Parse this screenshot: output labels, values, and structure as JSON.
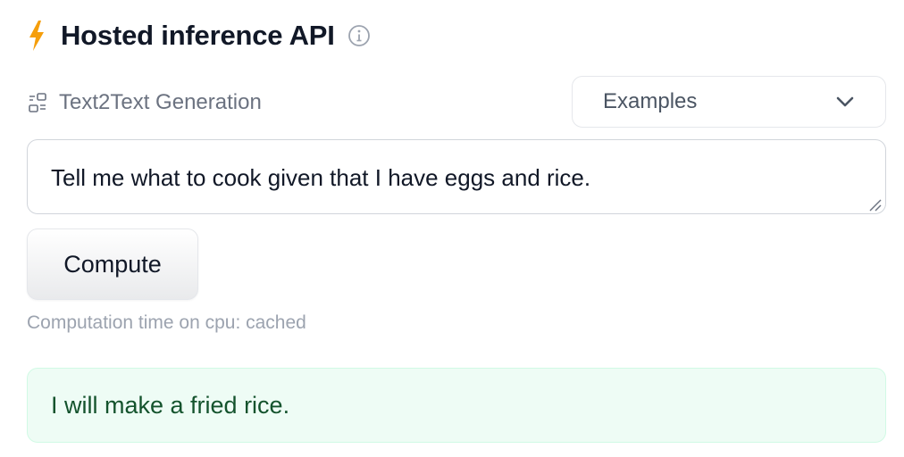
{
  "header": {
    "title": "Hosted inference API",
    "bolt_icon": "lightning-bolt-icon",
    "info_icon": "info-icon"
  },
  "task": {
    "icon": "task-icon",
    "label": "Text2Text Generation"
  },
  "examples": {
    "label": "Examples",
    "icon": "chevron-down-icon"
  },
  "input": {
    "value": "Tell me what to cook given that I have eggs and rice."
  },
  "compute": {
    "label": "Compute"
  },
  "computation_time": "Computation time on cpu: cached",
  "output": {
    "text": "I will make a fried rice."
  },
  "colors": {
    "accent": "#f59e0b",
    "output_bg": "#eefcf5",
    "output_text": "#14532d"
  }
}
